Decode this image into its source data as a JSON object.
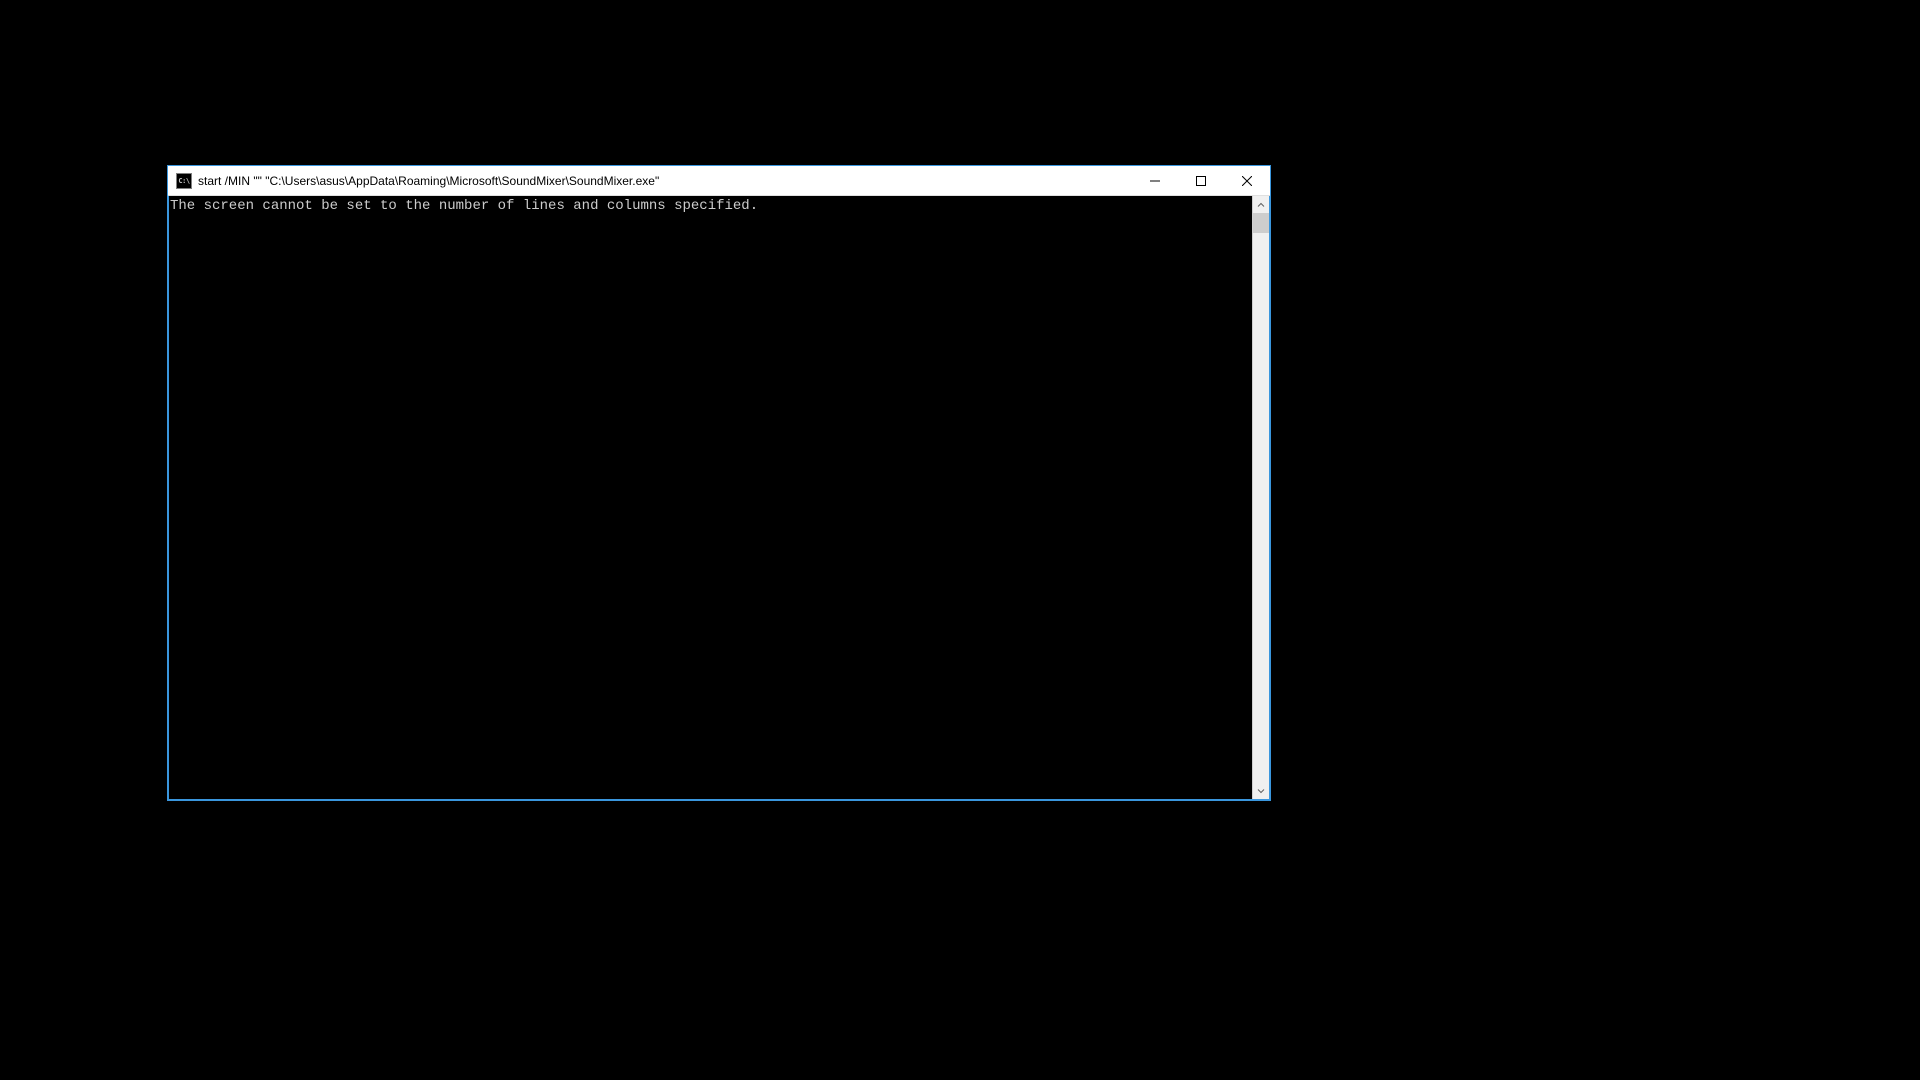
{
  "window": {
    "icon_text": "C:\\",
    "title": "start  /MIN \"\" \"C:\\Users\\asus\\AppData\\Roaming\\Microsoft\\SoundMixer\\SoundMixer.exe\"",
    "controls": {
      "minimize": "minimize",
      "maximize": "maximize",
      "close": "close"
    }
  },
  "terminal": {
    "output": "The screen cannot be set to the number of lines and columns specified."
  }
}
